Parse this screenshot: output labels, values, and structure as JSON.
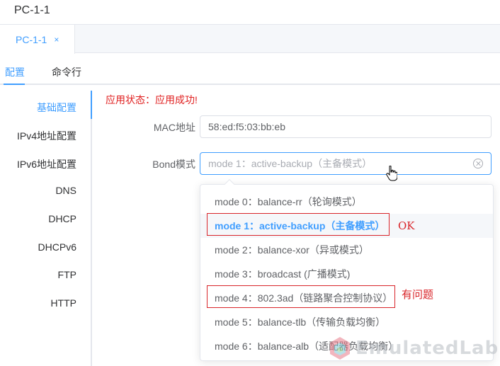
{
  "window": {
    "title": "PC-1-1"
  },
  "tabs": [
    {
      "label": "PC-1-1",
      "close": "×"
    }
  ],
  "subtabs": [
    {
      "label": "配置"
    },
    {
      "label": "命令行"
    }
  ],
  "sidebar": {
    "items": [
      {
        "label": "基础配置"
      },
      {
        "label": "IPv4地址配置"
      },
      {
        "label": "IPv6地址配置"
      },
      {
        "label": "DNS"
      },
      {
        "label": "DHCP"
      },
      {
        "label": "DHCPv6"
      },
      {
        "label": "FTP"
      },
      {
        "label": "HTTP"
      }
    ]
  },
  "form": {
    "status": "应用状态：应用成功!",
    "mac_label": "MAC地址",
    "mac_value": "58:ed:f5:03:bb:eb",
    "bond_label": "Bond模式",
    "bond_placeholder": "mode 1：active-backup（主备模式）"
  },
  "dropdown": {
    "options": [
      {
        "label": "mode 0：balance-rr（轮询模式）"
      },
      {
        "label": "mode 1：active-backup（主备模式）"
      },
      {
        "label": "mode 2：balance-xor（异或模式）"
      },
      {
        "label": "mode 3：broadcast (广播模式)"
      },
      {
        "label": "mode 4：802.3ad（链路聚合控制协议）"
      },
      {
        "label": "mode 5：balance-tlb（传输负载均衡）"
      },
      {
        "label": "mode 6：balance-alb（适配器负载均衡）"
      }
    ],
    "selected_index": 1
  },
  "annotations": {
    "ok": "OK",
    "problem": "有问题"
  },
  "watermark": {
    "text": "EmulatedLab"
  },
  "colors": {
    "accent": "#409eff",
    "annotation": "#d9252a",
    "status": "#e02020"
  }
}
